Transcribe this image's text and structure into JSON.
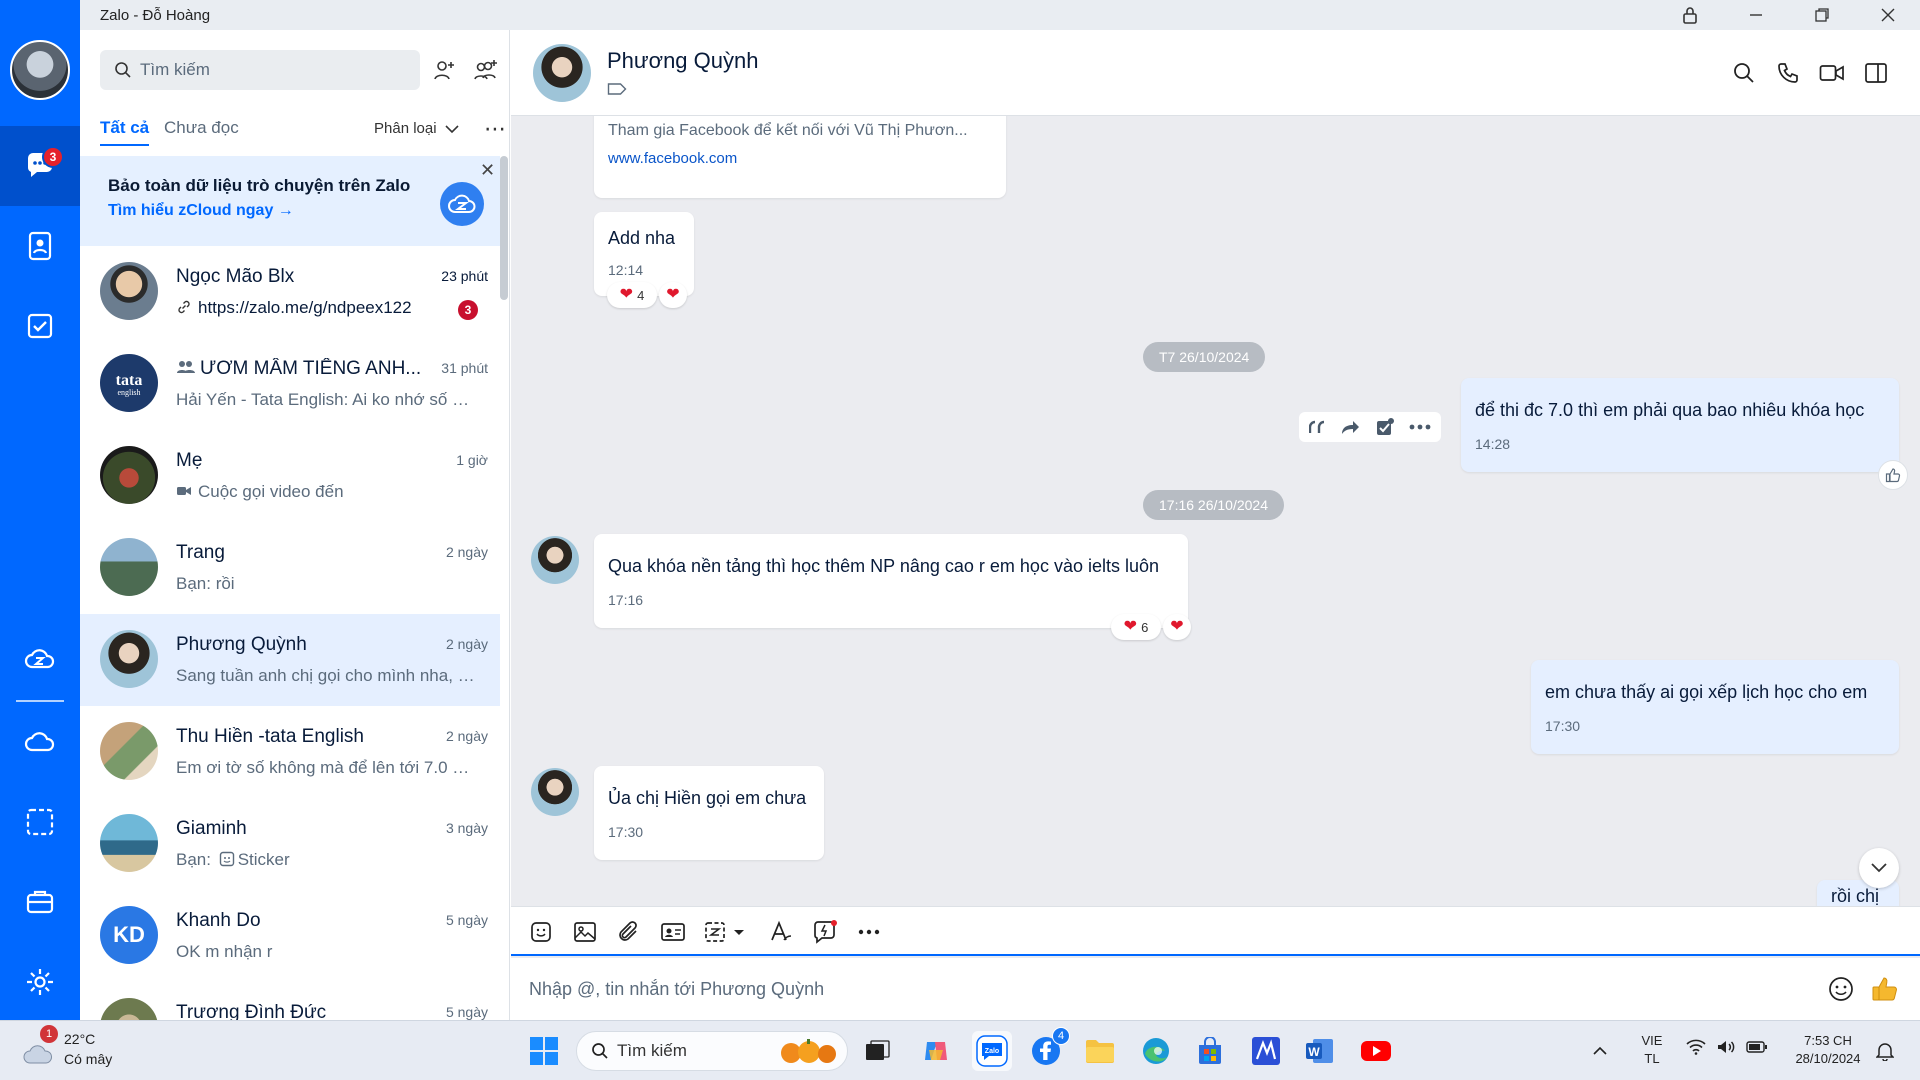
{
  "window": {
    "title": "Zalo - Đỗ Hoàng",
    "controls": [
      "lock",
      "minimize",
      "restore",
      "close"
    ]
  },
  "rail": {
    "chat_badge": "3",
    "items": [
      "chat-icon",
      "contacts-icon",
      "todo-icon",
      "zcloud-icon",
      "cloud-icon",
      "screenshot-icon",
      "briefcase-icon",
      "settings-icon"
    ]
  },
  "list": {
    "search_placeholder": "Tìm kiếm",
    "tabs": {
      "all": "Tất cả",
      "unread": "Chưa đọc"
    },
    "filter_label": "Phân loại",
    "more": "⋯",
    "promo": {
      "title": "Bảo toàn dữ liệu trò chuyện trên Zalo",
      "link": "Tìm hiểu zCloud ngay →"
    },
    "conversations": [
      {
        "name": "Ngọc Mão Blx",
        "time": "23 phút",
        "preview": "https://zalo.me/g/ndpeex122",
        "unread": "3"
      },
      {
        "name": "ƯƠM MẦM TIẾNG ANH...",
        "time": "31 phút",
        "preview": "Hải Yến - Tata English: Ai ko nhớ số m..."
      },
      {
        "name": "Mẹ",
        "time": "1 giờ",
        "preview": "Cuộc gọi video đến"
      },
      {
        "name": "Trang",
        "time": "2 ngày",
        "preview": "Bạn: rồi"
      },
      {
        "name": "Phương Quỳnh",
        "time": "2 ngày",
        "preview": "Sang tuần anh chị gọi cho mình nha, c..."
      },
      {
        "name": "Thu Hiền -tata English",
        "time": "2 ngày",
        "preview": "Em ơi tờ số không mà để lên tới 7.0 ai ..."
      },
      {
        "name": "Giaminh",
        "time": "3 ngày",
        "preview": "Bạn: Sticker"
      },
      {
        "name": "Khanh Do",
        "time": "5 ngày",
        "preview": "OK m nhận r",
        "initials": "KD"
      },
      {
        "name": "Trương Đình Đức",
        "time": "5 ngày",
        "preview": ""
      }
    ]
  },
  "chat": {
    "name": "Phương Quỳnh",
    "link_preview": {
      "desc": "Tham gia Facebook để kết nối với Vũ Thị Phươn...",
      "url": "www.facebook.com"
    },
    "messages": [
      {
        "text": "Add nha",
        "time": "12:14",
        "reaction_count": "4"
      },
      {
        "date": "T7 26/10/2024"
      },
      {
        "text": "để thi đc 7.0 thì em phải qua bao nhiêu khóa học",
        "time": "14:28",
        "mine": true
      },
      {
        "date": "17:16 26/10/2024"
      },
      {
        "text": "Qua khóa nền tảng thì học thêm NP nâng cao r em học vào ielts luôn",
        "time": "17:16",
        "reaction_count": "6"
      },
      {
        "text": "em chưa thấy ai gọi xếp lịch học cho em",
        "time": "17:30",
        "mine": true
      },
      {
        "text": "Ủa chị Hiền gọi em chưa",
        "time": "17:30"
      },
      {
        "text": "rồi chị",
        "mine": true
      }
    ],
    "composer_placeholder": "Nhập @, tin nhắn tới Phương Quỳnh"
  },
  "taskbar": {
    "weather": {
      "temp": "22°C",
      "desc": "Có mây",
      "badge": "1"
    },
    "search_label": "Tìm kiếm",
    "facebook_badge": "4",
    "lang": "VIE",
    "lang_sub": "TL",
    "time": "7:53 CH",
    "date": "28/10/2024"
  },
  "colors": {
    "brand": "#0068ff",
    "rail_active": "#0050cc",
    "chat_bg": "#ebecf0",
    "mine_bubble": "#e5efff",
    "unread_badge": "#c8102e"
  }
}
